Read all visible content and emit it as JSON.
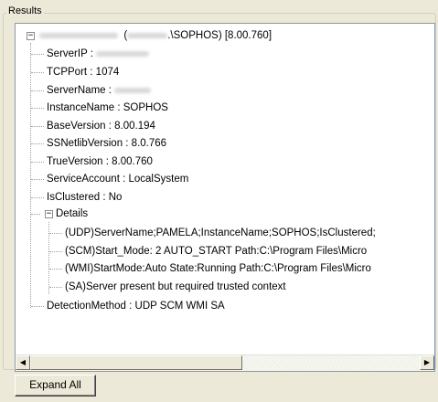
{
  "group": {
    "title": "Results"
  },
  "tree": {
    "root": {
      "label_suffix": ".\\SOPHOS)  [8.00.760]",
      "expander": "−",
      "children": [
        {
          "key": "ServerIP",
          "label": "ServerIP : ",
          "redacted": true
        },
        {
          "key": "TCPPort",
          "label": "TCPPort : 1074"
        },
        {
          "key": "ServerName",
          "label": "ServerName : ",
          "redacted": true
        },
        {
          "key": "InstanceName",
          "label": "InstanceName : SOPHOS"
        },
        {
          "key": "BaseVersion",
          "label": "BaseVersion : 8.00.194"
        },
        {
          "key": "SSNetlibVersion",
          "label": "SSNetlibVersion : 8.0.766"
        },
        {
          "key": "TrueVersion",
          "label": "TrueVersion : 8.00.760"
        },
        {
          "key": "ServiceAccount",
          "label": "ServiceAccount : LocalSystem"
        },
        {
          "key": "IsClustered",
          "label": "IsClustered : No"
        }
      ],
      "details": {
        "label": "Details",
        "expander": "−",
        "children": [
          "(UDP)ServerName;PAMELA;InstanceName;SOPHOS;IsClustered;",
          "(SCM)Start_Mode: 2   AUTO_START   Path:C:\\Program Files\\Micro",
          "(WMI)StartMode:Auto State:Running Path:C:\\Program Files\\Micro",
          "(SA)Server present but required trusted context"
        ]
      },
      "detection": "DetectionMethod : UDP SCM WMI SA"
    }
  },
  "scrollbar": {
    "left_arrow": "◀",
    "right_arrow": "▶"
  },
  "buttons": {
    "expand_all": "Expand All"
  }
}
